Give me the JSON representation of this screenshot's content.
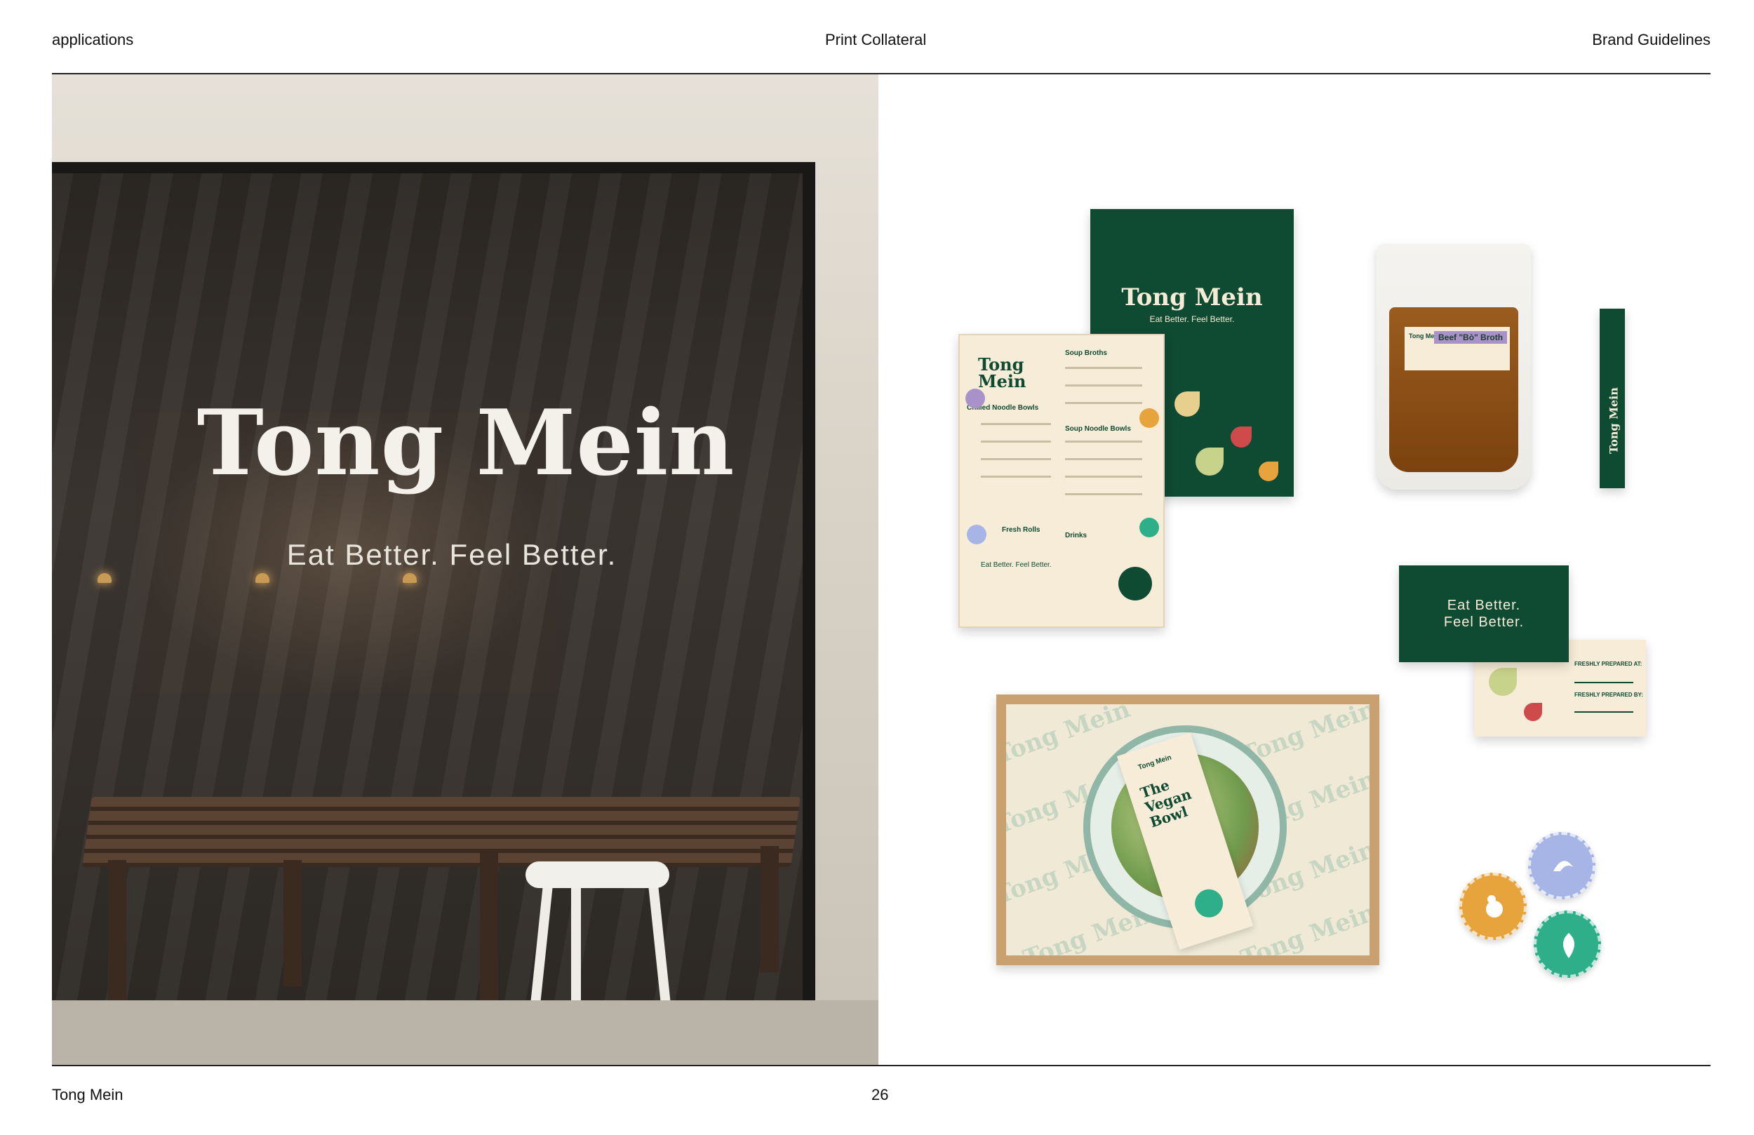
{
  "header": {
    "left": "applications",
    "center": "Print Collateral",
    "right": "Brand Guidelines"
  },
  "footer": {
    "left": "Tong Mein",
    "page": "26"
  },
  "storefront": {
    "title": "Tong Mein",
    "tagline": "Eat Better. Feel Better."
  },
  "menu_cover": {
    "title": "Tong Mein",
    "tagline": "Eat Better. Feel Better."
  },
  "menu": {
    "title": "Tong Mein",
    "sections": [
      "Soup Broths",
      "Soup Noodle Bowls",
      "Chilled Noodle Bowls",
      "Fresh Rolls",
      "Drinks"
    ],
    "footer": "Eat Better. Feel Better."
  },
  "pouch": {
    "brand": "Tong Mein",
    "name": "Beef \"Bò\" Broth"
  },
  "chopsticks": {
    "brand": "Tong Mein"
  },
  "business_card": {
    "line1": "Eat Better.",
    "line2": "Feel Better."
  },
  "prep_card": {
    "field1": "FRESHLY PREPARED AT:",
    "field2": "FRESHLY PREPARED BY:"
  },
  "tray": {
    "pattern_word": "Tong Mein",
    "sleeve_brand": "Tong Mein",
    "sleeve_title": "The Vegan Bowl"
  },
  "colors": {
    "brand_green": "#0f4a33",
    "cream": "#f6ecd7",
    "purple": "#a992c9",
    "orange": "#e8a43c",
    "teal": "#2fae8a"
  }
}
